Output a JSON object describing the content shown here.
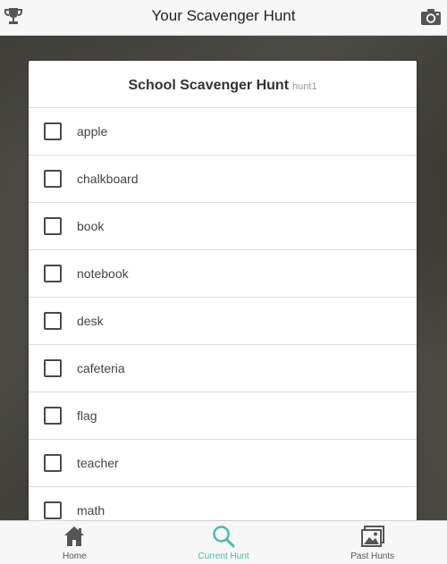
{
  "header": {
    "title": "Your Scavenger Hunt",
    "left_icon": "trophy-icon",
    "right_icon": "camera-icon"
  },
  "hunt": {
    "title": "School Scavenger Hunt",
    "subtitle": "hunt1",
    "items": [
      {
        "label": "apple",
        "checked": false
      },
      {
        "label": "chalkboard",
        "checked": false
      },
      {
        "label": "book",
        "checked": false
      },
      {
        "label": "notebook",
        "checked": false
      },
      {
        "label": "desk",
        "checked": false
      },
      {
        "label": "cafeteria",
        "checked": false
      },
      {
        "label": "flag",
        "checked": false
      },
      {
        "label": "teacher",
        "checked": false
      },
      {
        "label": "math",
        "checked": false
      }
    ]
  },
  "tabs": [
    {
      "label": "Home",
      "icon": "home-icon",
      "active": false
    },
    {
      "label": "Current Hunt",
      "icon": "search-icon",
      "active": true
    },
    {
      "label": "Past Hunts",
      "icon": "gallery-icon",
      "active": false
    }
  ],
  "colors": {
    "accent": "#46bfa8",
    "icon": "#555555"
  }
}
